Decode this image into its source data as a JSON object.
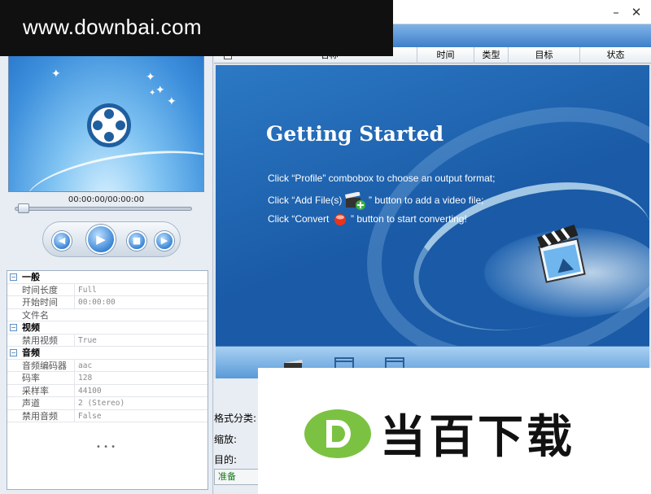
{
  "watermark": {
    "url": "www.downbai.com",
    "logo_text": "当百下载"
  },
  "window": {
    "minimize": "–",
    "close": "✕"
  },
  "player": {
    "time": "00:00:00/00:00:00"
  },
  "properties": [
    {
      "group": true,
      "key": "一般",
      "expander": "−"
    },
    {
      "group": false,
      "key": "时间长度",
      "value": "Full"
    },
    {
      "group": false,
      "key": "开始时间",
      "value": "00:00:00"
    },
    {
      "group": false,
      "key": "文件名",
      "value": ""
    },
    {
      "group": true,
      "key": "视频",
      "expander": "−"
    },
    {
      "group": false,
      "key": "禁用视频",
      "value": "True"
    },
    {
      "group": true,
      "key": "音频",
      "expander": "−"
    },
    {
      "group": false,
      "key": "音频编码器",
      "value": "aac"
    },
    {
      "group": false,
      "key": "码率",
      "value": "128"
    },
    {
      "group": false,
      "key": "采样率",
      "value": "44100"
    },
    {
      "group": false,
      "key": "声道",
      "value": "2 (Stereo)"
    },
    {
      "group": false,
      "key": "禁用音频",
      "value": "False"
    }
  ],
  "prop_footer": "• • •",
  "list": {
    "columns": [
      "名称",
      "时间",
      "类型",
      "目标",
      "状态"
    ]
  },
  "getting_started": {
    "title": "Getting Started",
    "line1": "Click “Profile” combobox to choose an output format;",
    "line2a": "Click “Add File(s)",
    "line2b": "” button to add a video file;",
    "line3a": "Click “Convert",
    "line3b": "” button to start converting!"
  },
  "form": {
    "format_label": "格式分类:",
    "zoom_label": "缩放:",
    "target_label": "目的:"
  },
  "status": "准备",
  "colors": {
    "accent": "#2c79c4",
    "logo_green": "#7cc242"
  }
}
